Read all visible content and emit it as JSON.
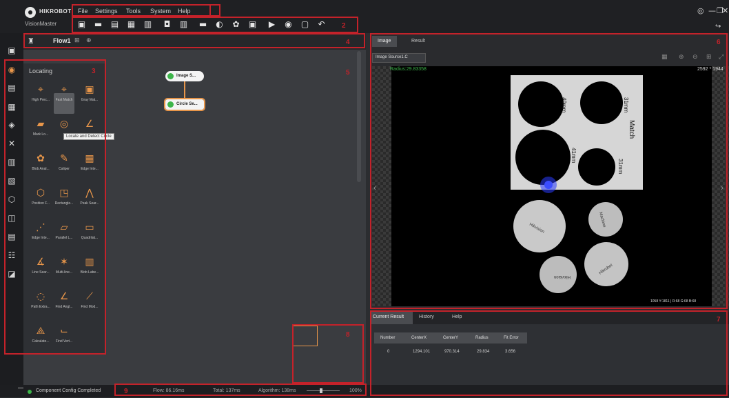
{
  "app": {
    "brand": "HIKROBOT",
    "name": "VisionMaster"
  },
  "menu": [
    "File",
    "Settings",
    "Tools",
    "System",
    "Help"
  ],
  "toolbar_icons": [
    "save-icon",
    "open-folder-icon",
    "save-as-icon",
    "grid-icon",
    "layout-icon",
    "camera-icon",
    "controller-icon",
    "list-icon",
    "contrast-icon",
    "settings-icon",
    "panel-icon",
    "play-once-icon",
    "run-icon",
    "stop-icon",
    "undo-icon"
  ],
  "flow": {
    "tab_label": "Flow1",
    "nodes": [
      {
        "num": "0",
        "label": "Image S..."
      },
      {
        "num": "1",
        "label": "Circle Se..."
      }
    ]
  },
  "palette": {
    "title": "Locating",
    "tools": [
      {
        "label": "High Prec...",
        "icon": "target-icon"
      },
      {
        "label": "Fast Match",
        "icon": "target-icon"
      },
      {
        "label": "Gray Mat...",
        "icon": "image-icon"
      },
      {
        "label": "Mark Lo...",
        "icon": "mark-icon"
      },
      {
        "label": "",
        "icon": "circle-search-icon"
      },
      {
        "label": "",
        "icon": "angle-icon"
      },
      {
        "label": "Blob Anal...",
        "icon": "blob-icon"
      },
      {
        "label": "Caliper",
        "icon": "caliper-icon"
      },
      {
        "label": "Edge Inte...",
        "icon": "edge-icon"
      },
      {
        "label": "Position F...",
        "icon": "position-icon"
      },
      {
        "label": "Rectangle...",
        "icon": "rectangle-icon"
      },
      {
        "label": "Peak Sear...",
        "icon": "peak-icon"
      },
      {
        "label": "Edge Inte...",
        "icon": "edge-icon"
      },
      {
        "label": "Parallel L...",
        "icon": "parallel-icon"
      },
      {
        "label": "Quadrilat...",
        "icon": "quad-icon"
      },
      {
        "label": "Line Sear...",
        "icon": "line-icon"
      },
      {
        "label": "Multi-line...",
        "icon": "multiline-icon"
      },
      {
        "label": "Blob Labe...",
        "icon": "blob-label-icon"
      },
      {
        "label": "Path Extra...",
        "icon": "path-icon"
      },
      {
        "label": "Find Angl...",
        "icon": "angle-icon"
      },
      {
        "label": "Find Mod...",
        "icon": "model-icon"
      },
      {
        "label": "Calculate...",
        "icon": "calc-icon"
      },
      {
        "label": "Find Vert...",
        "icon": "vertex-icon"
      }
    ],
    "tooltip": "Locate and Detect Circle"
  },
  "image_panel": {
    "tabs": [
      "Image",
      "Result"
    ],
    "source": "Image Source1.C",
    "overlay": "Radius:29.83358",
    "resolution": "2592 * 1944",
    "coords": "1058 Y:1811 | R:68 G:68 B:68",
    "labels": [
      {
        "id": "label-40mm",
        "text": "40mm"
      },
      {
        "id": "label-31mm",
        "text": "31mm"
      },
      {
        "id": "label-match",
        "text": "Match"
      },
      {
        "id": "label-41mm",
        "text": "41mm"
      },
      {
        "id": "label-31mm-b",
        "text": "31mm"
      },
      {
        "id": "coin-1",
        "text": "Hikvision"
      },
      {
        "id": "coin-2",
        "text": "Machine"
      },
      {
        "id": "coin-3",
        "text": "Hikvision"
      },
      {
        "id": "coin-4",
        "text": "Hikrobot"
      }
    ]
  },
  "results": {
    "tabs": [
      "Current Result",
      "History",
      "Help"
    ],
    "columns": [
      "Number",
      "CenterX",
      "CenterY",
      "Radius",
      "Fit Error"
    ],
    "rows": [
      [
        "0",
        "1294.101",
        "970.314",
        "29.834",
        "3.656"
      ]
    ]
  },
  "status": {
    "message": "Component Config Completed",
    "flow_time": "Flow: 86.16ms",
    "total_time": "Total: 137ms",
    "algorithm_time": "Algorithm: 138ms",
    "zoom": "100%"
  },
  "colors": {
    "accent": "#e8964a",
    "highlight_box": "#c4222a",
    "ok": "#3db54a"
  }
}
